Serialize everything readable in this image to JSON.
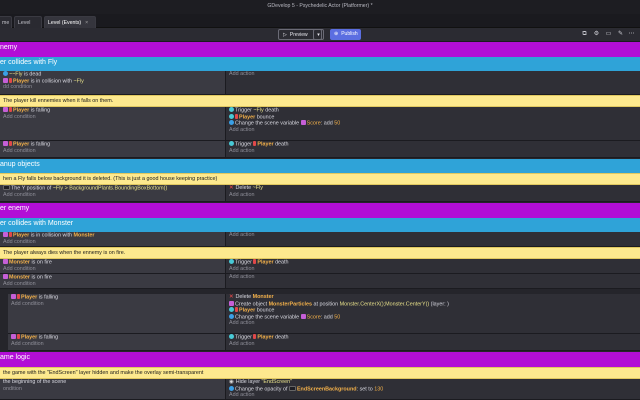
{
  "window": {
    "title": "GDevelop 5 - Psychedelic Actor (Platformer) *"
  },
  "tabs": [
    {
      "label": "me"
    },
    {
      "label": "Level"
    },
    {
      "label": "Level (Events)",
      "close": "×"
    }
  ],
  "toolbar": {
    "preview_label": "Preview",
    "caret": "▾",
    "publish_label": "Publish"
  },
  "groups": {
    "enemy": "nemy",
    "fly_collide": "er collides with Fly",
    "cleanup": "anup objects",
    "player_enemy": "er enemy",
    "monster_collide": "er collides with Monster",
    "game_logic": "ame logic"
  },
  "comments": {
    "kill_enemies": "The player kill ennemies when it falls on them.",
    "fly_below": "hen a Fly falls below background it is deleted. (This is just a good house keeping practice)",
    "dies_on_fire": "The player always dies when the ennemy is on fire.",
    "endscreen": "the game with the \"EndScreen\" layer hidden and make the overlay semi-transparent"
  },
  "common": {
    "add_condition": "Add condition",
    "add_action": "Add action"
  },
  "fly_event": {
    "c1_obj": "~Fly",
    "c1_text": "is dead",
    "c2_obj": "Player",
    "c2_text": "is in collision with",
    "c2_obj2": "~Fly",
    "c3": "dd condition"
  },
  "falling_event": {
    "c_obj": "Player",
    "c_text": "is falling",
    "a1_text": "Trigger",
    "a1_obj": "~Fly",
    "a1_rest": "death",
    "a2_obj": "Player",
    "a2_text": "bounce",
    "a3_text": "Change the scene variable",
    "a3_var": "Score",
    "a3_rest": ": add",
    "a3_val": "50"
  },
  "notfalling_event": {
    "c_obj": "Player",
    "c_text": "is falling",
    "a_text": "Trigger",
    "a_obj": "Player",
    "a_rest": "death"
  },
  "cleanup_event": {
    "c_text": "The Y position of",
    "c_obj": "~Fly",
    "c_rest": "> BackgroundPlants.BoundingBoxBottom()",
    "a_text": "Delete",
    "a_obj": "~Fly"
  },
  "monster_event": {
    "c_obj": "Player",
    "c_text": "is in collision with",
    "c_obj2": "Monster"
  },
  "fire_event": {
    "c_obj": "Monster",
    "c_text": "is on fire",
    "a_text": "Trigger",
    "a_obj": "Player",
    "a_rest": "death"
  },
  "notfire_event": {
    "c_obj": "Monster",
    "c_text": "is on fire"
  },
  "monster_falling": {
    "c_obj": "Player",
    "c_text": "is falling",
    "a1_text": "Delete",
    "a1_obj": "Monster",
    "a2_text": "Create object",
    "a2_obj": "MonsterParticles",
    "a2_rest": "at position",
    "a2_pos": "Monster.CenterX();Monster.CenterY()",
    "a2_layer": "(layer: )",
    "a3_obj": "Player",
    "a3_text": "bounce",
    "a4_text": "Change the scene variable",
    "a4_var": "Score",
    "a4_rest": ": add",
    "a4_val": "50"
  },
  "monster_notfalling": {
    "c_obj": "Player",
    "c_text": "is falling",
    "a_text": "Trigger",
    "a_obj": "Player",
    "a_rest": "death"
  },
  "start_event": {
    "c_text": "the beginning of the scene",
    "c2": "ondition",
    "a1_text": "Hide layer",
    "a1_val": "\"EndScreen\"",
    "a2_text": "Change the opacity of",
    "a2_obj": "EndScreenBackground",
    "a2_rest": ": set to",
    "a2_val": "130"
  },
  "colors": {
    "purple_group": "#b20ed6",
    "blue_group": "#2fa3d8",
    "comment": "#fde98e",
    "publish": "#5b6ee1"
  },
  "icons": [
    "preview-icon",
    "publish-icon",
    "share-icon",
    "debug-icon",
    "chat-icon",
    "more-icon"
  ]
}
